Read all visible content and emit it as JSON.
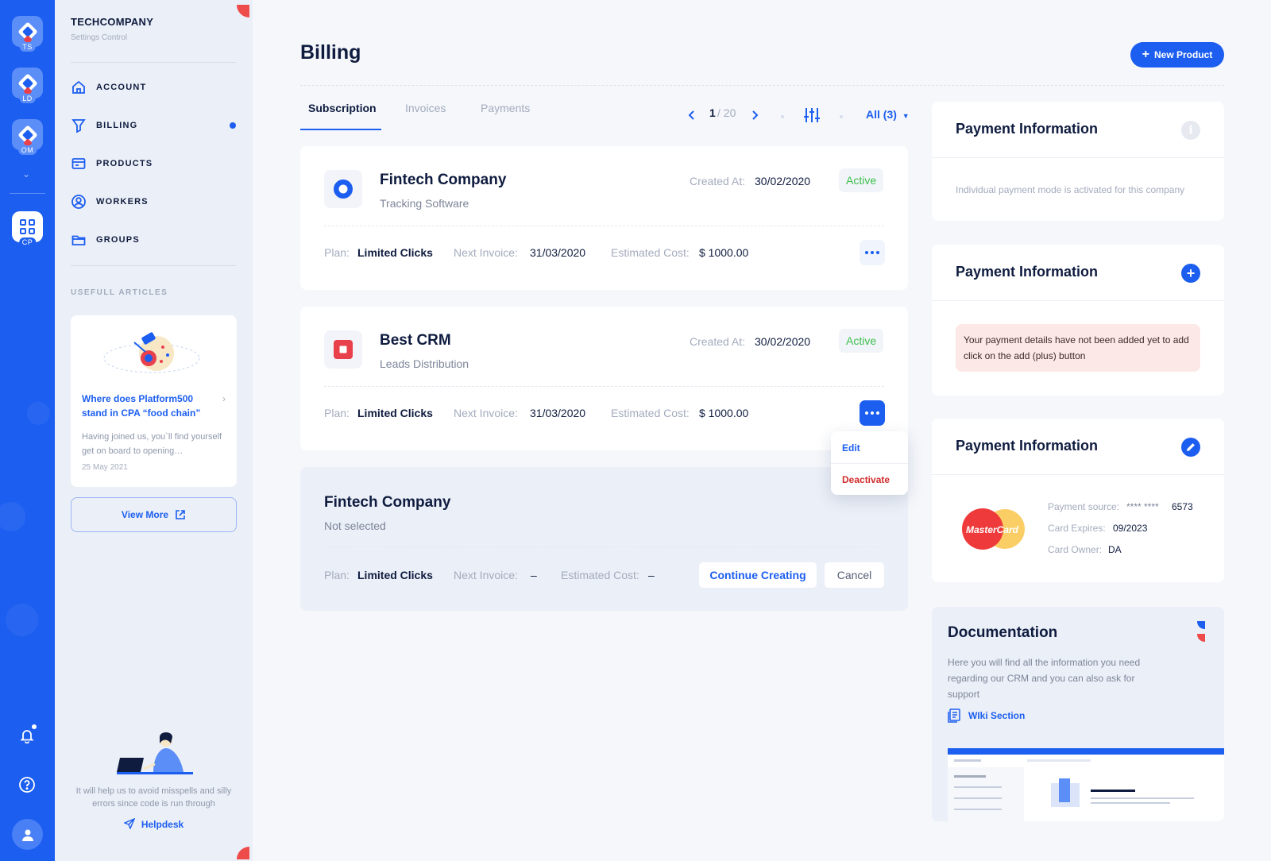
{
  "rail": {
    "workspaces": [
      {
        "tag": "TS"
      },
      {
        "tag": "LD"
      },
      {
        "tag": "OM"
      },
      {
        "tag": "CP"
      }
    ]
  },
  "sidebar": {
    "brand_title": "TECHCOMPANY",
    "brand_subtitle": "Settings Control",
    "nav": [
      {
        "label": "ACCOUNT",
        "icon": "home-icon"
      },
      {
        "label": "BILLING",
        "icon": "filter-icon",
        "active": true
      },
      {
        "label": "PRODUCTS",
        "icon": "box-icon"
      },
      {
        "label": "WORKERS",
        "icon": "user-circle-icon"
      },
      {
        "label": "GROUPS",
        "icon": "folder-icon"
      }
    ],
    "articles_title": "USEFULL ARTICLES",
    "article": {
      "title": "Where does Platform500 stand in CPA “food chain”",
      "text": "Having joined us, you`ll find yourself get on board to opening…",
      "date": "25 May 2021"
    },
    "view_more": "View More",
    "help_text": "It will help us to avoid misspells and silly errors since code is run through",
    "helpdesk": "Helpdesk"
  },
  "header": {
    "title": "Billing",
    "new_product": "New Product"
  },
  "tabs": [
    "Subscription",
    "Invoices",
    "Payments"
  ],
  "pager": {
    "current": "1",
    "total": "/ 20"
  },
  "filter": {
    "label": "All (3)"
  },
  "subscriptions": [
    {
      "name": "Fintech Company",
      "sub": "Tracking Software",
      "created_label": "Created At:",
      "created": "30/02/2020",
      "status": "Active",
      "plan_label": "Plan:",
      "plan": "Limited Clicks",
      "next_label": "Next Invoice:",
      "next": "31/03/2020",
      "cost_label": "Estimated Cost:",
      "cost": "$ 1000.00"
    },
    {
      "name": "Best CRM",
      "sub": "Leads Distribution",
      "created_label": "Created At:",
      "created": "30/02/2020",
      "status": "Active",
      "plan_label": "Plan:",
      "plan": "Limited Clicks",
      "next_label": "Next Invoice:",
      "next": "31/03/2020",
      "cost_label": "Estimated Cost:",
      "cost": "$ 1000.00"
    }
  ],
  "dropdown": {
    "edit": "Edit",
    "deactivate": "Deactivate"
  },
  "draft": {
    "name": "Fintech Company",
    "sub": "Not selected",
    "plan_label": "Plan:",
    "plan": "Limited Clicks",
    "next_label": "Next Invoice:",
    "next": "–",
    "cost_label": "Estimated Cost:",
    "cost": "–",
    "continue": "Continue Creating",
    "cancel": "Cancel"
  },
  "payment_panels": [
    {
      "title": "Payment Information",
      "text": "Individual payment mode is activated for this company"
    },
    {
      "title": "Payment Information",
      "alert": "Your payment details have not been added yet to add click on the add (plus) button"
    },
    {
      "title": "Payment Information",
      "card_brand": "MasterCard",
      "source_label": "Payment source:",
      "source_mask": "**** ****",
      "source_last": "6573",
      "expires_label": "Card Expires:",
      "expires": "09/2023",
      "owner_label": "Card Owner:",
      "owner": "DA"
    }
  ],
  "documentation": {
    "title": "Documentation",
    "text": "Here you will find all the information you need regarding our CRM and you can also ask for support",
    "link": "WIki Section"
  },
  "colors": {
    "accent": "#1c5ef0",
    "success": "#3dbf4b",
    "danger": "#e8414c"
  }
}
